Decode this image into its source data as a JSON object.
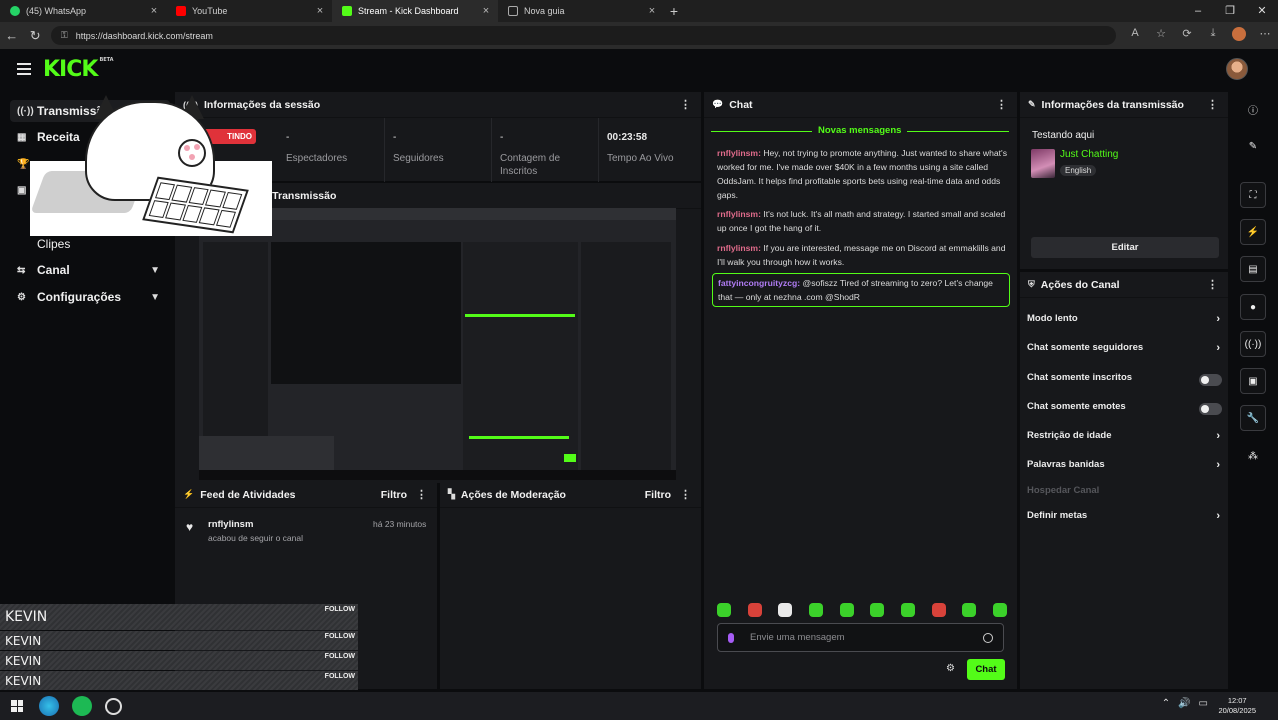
{
  "browser": {
    "tabs": [
      {
        "title": "(45) WhatsApp",
        "color": "#25d366"
      },
      {
        "title": "YouTube",
        "color": "#ff0000"
      },
      {
        "title": "Stream - Kick Dashboard",
        "color": "#53fc18"
      },
      {
        "title": "Nova guia",
        "color": "#888888"
      }
    ],
    "url": "https://dashboard.kick.com/stream"
  },
  "header": {
    "logo": "KICK",
    "logo_badge": "BETA"
  },
  "sidebar": {
    "items": [
      {
        "label": "Transmissão",
        "icon": "broadcast-icon"
      },
      {
        "label": "Receita",
        "icon": "chart-icon"
      },
      {
        "label": "Clipes",
        "icon": ""
      },
      {
        "label": "Canal",
        "icon": "channel-icon"
      },
      {
        "label": "Configurações",
        "icon": "gear-icon"
      }
    ]
  },
  "session": {
    "title": "Informações da sessão",
    "live_badge": "TINDO",
    "stats": [
      {
        "value": "-",
        "label": "Espectadores"
      },
      {
        "value": "-",
        "label": "Seguidores"
      },
      {
        "value": "-",
        "label": "Contagem de Inscritos"
      },
      {
        "value": "00:23:58",
        "label": "Tempo Ao Vivo"
      }
    ]
  },
  "preview": {
    "title": "de Transmissão"
  },
  "activity": {
    "title": "Feed de Atividades",
    "filter": "Filtro",
    "items": [
      {
        "name": "rnflylinsm",
        "text": "acabou de seguir o canal",
        "time": "há 23 minutos"
      }
    ]
  },
  "moderation": {
    "title": "Ações de Moderação",
    "filter": "Filtro"
  },
  "kevin_overlay": [
    {
      "name": "KEVIN",
      "follow": "FOLLOW"
    },
    {
      "name": "KEVIN",
      "follow": "FOLLOW"
    },
    {
      "name": "KEVIN",
      "follow": "FOLLOW"
    },
    {
      "name": "KEVIN",
      "follow": "FOLLOW"
    }
  ],
  "chat": {
    "title": "Chat",
    "new_messages": "Novas mensagens",
    "messages": [
      {
        "user": "rnflylinsm:",
        "text": " Hey, not trying to promote anything. Just wanted to share what's worked for me. I've made over $40K in a few months using a site called OddsJam. It helps find profitable sports bets using real-time data and odds gaps."
      },
      {
        "user": "rnflylinsm:",
        "text": " It's not luck. It's all math and strategy. I started small and scaled up once I got the hang of it."
      },
      {
        "user": "rnflylinsm:",
        "text": " If you are interested, message me on Discord at emmaklills and I'll walk you through how it works."
      },
      {
        "user": "fattyincongruityzcg:",
        "text": " @sofiszz Tired of streaming to zero? Let's change that — only at nezhna .com @ShodR"
      }
    ],
    "placeholder": "Envie uma mensagem",
    "send": "Chat"
  },
  "stream_info": {
    "title": "Informações da transmissão",
    "stream_title": "Testando aqui",
    "category": "Just Chatting",
    "tag": "English",
    "edit": "Editar"
  },
  "channel_actions": {
    "title": "Ações do Canal",
    "items": [
      {
        "label": "Modo lento",
        "control": "chevron"
      },
      {
        "label": "Chat somente seguidores",
        "control": "chevron"
      },
      {
        "label": "Chat somente inscritos",
        "control": "toggle"
      },
      {
        "label": "Chat somente emotes",
        "control": "toggle"
      },
      {
        "label": "Restrição de idade",
        "control": "chevron"
      },
      {
        "label": "Palavras banidas",
        "control": "chevron"
      },
      {
        "label": "Hospedar Canal",
        "control": "none"
      },
      {
        "label": "Definir metas",
        "control": "chevron"
      }
    ]
  },
  "taskbar": {
    "time": "12:07",
    "date": "20/08/2025"
  }
}
